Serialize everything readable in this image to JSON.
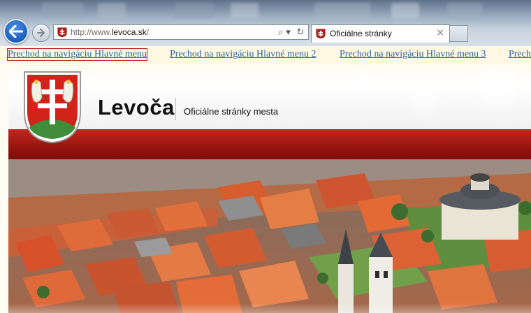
{
  "browser": {
    "url_prefix": "http://www.",
    "url_domain": "levoca.sk",
    "url_suffix": "/",
    "search_glyph": "⌕ ▾",
    "refresh_glyph": "↻",
    "tab_title": "Oficiálne stránky",
    "tab_close": "×",
    "icons": [
      "back-arrow-icon",
      "forward-arrow-icon",
      "search-icon",
      "refresh-icon",
      "site-favicon",
      "close-icon"
    ]
  },
  "skip_links": [
    "Prechod na navigáciu Hlavné menu",
    "Prechod na navigáciu Hlavné menu 2",
    "Prechod na navigáciu Hlavné menu 3",
    "Prech"
  ],
  "site": {
    "name": "Levoča",
    "subtitle": "Oficiálne stránky mesta"
  },
  "colors": {
    "brand_red": "#9c1610",
    "link_blue": "#2a5fa8",
    "focus_outline": "#b22222"
  }
}
